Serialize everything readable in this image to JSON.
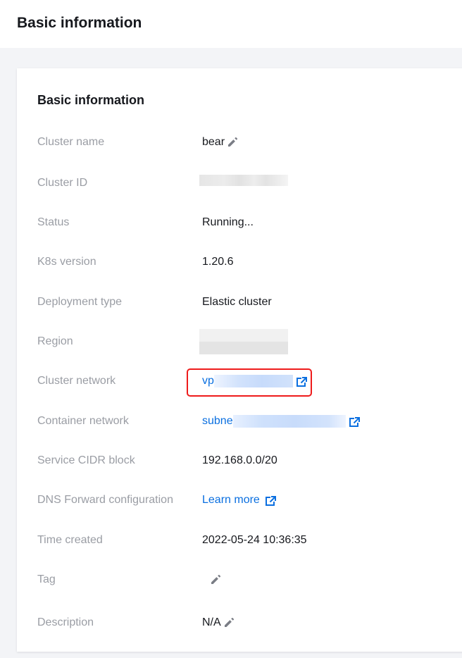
{
  "header": {
    "title": "Basic information"
  },
  "card": {
    "title": "Basic information",
    "rows": [
      {
        "label": "Cluster name",
        "value": "bear"
      },
      {
        "label": "Cluster ID",
        "value": ""
      },
      {
        "label": "Status",
        "value": "Running..."
      },
      {
        "label": "K8s version",
        "value": "1.20.6"
      },
      {
        "label": "Deployment type",
        "value": "Elastic cluster"
      },
      {
        "label": "Region",
        "value": ""
      },
      {
        "label": "Cluster network",
        "value": "vp"
      },
      {
        "label": "Container network",
        "value": "subne"
      },
      {
        "label": "Service CIDR block",
        "value": "192.168.0.0/20"
      },
      {
        "label": "DNS Forward configuration",
        "value": "Learn more"
      },
      {
        "label": "Time created",
        "value": "2022-05-24 10:36:35"
      },
      {
        "label": "Tag",
        "value": ""
      },
      {
        "label": "Description",
        "value": "N/A"
      }
    ]
  },
  "icons": {
    "edit": "pencil-icon",
    "external": "external-link-icon"
  },
  "colors": {
    "link": "#0a6fe0",
    "label": "#9a9da4",
    "text": "#16181d",
    "highlight": "#ee1b1b",
    "background": "#f3f4f7"
  }
}
